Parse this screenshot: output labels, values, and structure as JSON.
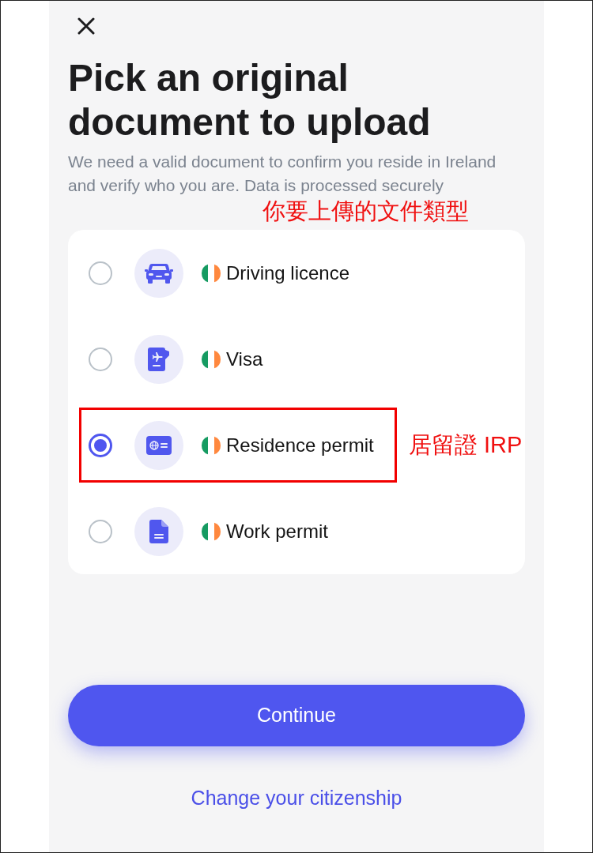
{
  "title": "Pick an original document to upload",
  "subtitle": "We need a valid document to confirm you reside in Ireland and verify who you are. Data is processed securely",
  "annotation": "你要上傳的文件類型",
  "options": [
    {
      "kind": "licence",
      "label": "Driving licence",
      "selected": false,
      "highlighted": false
    },
    {
      "kind": "visa",
      "label": "Visa",
      "selected": false,
      "highlighted": false
    },
    {
      "kind": "residence",
      "label": "Residence permit",
      "selected": true,
      "highlighted": true,
      "note": "居留證 IRP"
    },
    {
      "kind": "work",
      "label": "Work permit",
      "selected": false,
      "highlighted": false
    }
  ],
  "continue_button": {
    "label": "Continue"
  },
  "link": {
    "label": "Change your citizenship"
  }
}
